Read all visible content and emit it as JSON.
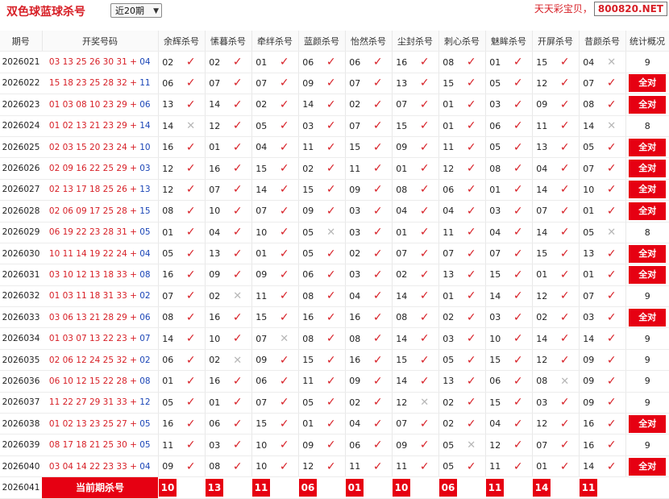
{
  "header": {
    "title": "双色球蓝球杀号",
    "period_select": "近20期",
    "brand": "天天彩宝贝",
    "site": "800820.NET"
  },
  "columns": [
    "期号",
    "开奖号码",
    "余辉杀号",
    "愫暮杀号",
    "牵绊杀号",
    "蓝颜杀号",
    "怡然杀号",
    "尘封杀号",
    "刺心杀号",
    "魅眸杀号",
    "开屏杀号",
    "昔颜杀号",
    "统计概况"
  ],
  "rows": [
    {
      "issue": "2026021",
      "red": "03 13 25 26 30 31",
      "blue": "04",
      "kills": [
        [
          "02",
          1
        ],
        [
          "02",
          1
        ],
        [
          "01",
          1
        ],
        [
          "06",
          1
        ],
        [
          "06",
          1
        ],
        [
          "16",
          1
        ],
        [
          "08",
          1
        ],
        [
          "01",
          1
        ],
        [
          "15",
          1
        ],
        [
          "04",
          0
        ]
      ],
      "stat": "9"
    },
    {
      "issue": "2026022",
      "red": "15 18 23 25 28 32",
      "blue": "11",
      "kills": [
        [
          "06",
          1
        ],
        [
          "07",
          1
        ],
        [
          "07",
          1
        ],
        [
          "09",
          1
        ],
        [
          "07",
          1
        ],
        [
          "13",
          1
        ],
        [
          "15",
          1
        ],
        [
          "05",
          1
        ],
        [
          "12",
          1
        ],
        [
          "07",
          1
        ]
      ],
      "stat": "全对"
    },
    {
      "issue": "2026023",
      "red": "01 03 08 10 23 29",
      "blue": "06",
      "kills": [
        [
          "13",
          1
        ],
        [
          "14",
          1
        ],
        [
          "02",
          1
        ],
        [
          "14",
          1
        ],
        [
          "02",
          1
        ],
        [
          "07",
          1
        ],
        [
          "01",
          1
        ],
        [
          "03",
          1
        ],
        [
          "09",
          1
        ],
        [
          "08",
          1
        ]
      ],
      "stat": "全对"
    },
    {
      "issue": "2026024",
      "red": "01 02 13 21 23 29",
      "blue": "14",
      "kills": [
        [
          "14",
          0
        ],
        [
          "12",
          1
        ],
        [
          "05",
          1
        ],
        [
          "03",
          1
        ],
        [
          "07",
          1
        ],
        [
          "15",
          1
        ],
        [
          "01",
          1
        ],
        [
          "06",
          1
        ],
        [
          "11",
          1
        ],
        [
          "14",
          0
        ]
      ],
      "stat": "8"
    },
    {
      "issue": "2026025",
      "red": "02 03 15 20 23 24",
      "blue": "10",
      "kills": [
        [
          "16",
          1
        ],
        [
          "01",
          1
        ],
        [
          "04",
          1
        ],
        [
          "11",
          1
        ],
        [
          "15",
          1
        ],
        [
          "09",
          1
        ],
        [
          "11",
          1
        ],
        [
          "05",
          1
        ],
        [
          "13",
          1
        ],
        [
          "05",
          1
        ]
      ],
      "stat": "全对"
    },
    {
      "issue": "2026026",
      "red": "02 09 16 22 25 29",
      "blue": "03",
      "kills": [
        [
          "12",
          1
        ],
        [
          "16",
          1
        ],
        [
          "15",
          1
        ],
        [
          "02",
          1
        ],
        [
          "11",
          1
        ],
        [
          "01",
          1
        ],
        [
          "12",
          1
        ],
        [
          "08",
          1
        ],
        [
          "04",
          1
        ],
        [
          "07",
          1
        ]
      ],
      "stat": "全对"
    },
    {
      "issue": "2026027",
      "red": "02 13 17 18 25 26",
      "blue": "13",
      "kills": [
        [
          "12",
          1
        ],
        [
          "07",
          1
        ],
        [
          "14",
          1
        ],
        [
          "15",
          1
        ],
        [
          "09",
          1
        ],
        [
          "08",
          1
        ],
        [
          "06",
          1
        ],
        [
          "01",
          1
        ],
        [
          "14",
          1
        ],
        [
          "10",
          1
        ]
      ],
      "stat": "全对"
    },
    {
      "issue": "2026028",
      "red": "02 06 09 17 25 28",
      "blue": "15",
      "kills": [
        [
          "08",
          1
        ],
        [
          "10",
          1
        ],
        [
          "07",
          1
        ],
        [
          "09",
          1
        ],
        [
          "03",
          1
        ],
        [
          "04",
          1
        ],
        [
          "04",
          1
        ],
        [
          "03",
          1
        ],
        [
          "07",
          1
        ],
        [
          "01",
          1
        ]
      ],
      "stat": "全对"
    },
    {
      "issue": "2026029",
      "red": "06 19 22 23 28 31",
      "blue": "05",
      "kills": [
        [
          "01",
          1
        ],
        [
          "04",
          1
        ],
        [
          "10",
          1
        ],
        [
          "05",
          0
        ],
        [
          "03",
          1
        ],
        [
          "01",
          1
        ],
        [
          "11",
          1
        ],
        [
          "04",
          1
        ],
        [
          "14",
          1
        ],
        [
          "05",
          0
        ]
      ],
      "stat": "8"
    },
    {
      "issue": "2026030",
      "red": "10 11 14 19 22 24",
      "blue": "04",
      "kills": [
        [
          "05",
          1
        ],
        [
          "13",
          1
        ],
        [
          "01",
          1
        ],
        [
          "05",
          1
        ],
        [
          "02",
          1
        ],
        [
          "07",
          1
        ],
        [
          "07",
          1
        ],
        [
          "07",
          1
        ],
        [
          "15",
          1
        ],
        [
          "13",
          1
        ]
      ],
      "stat": "全对"
    },
    {
      "issue": "2026031",
      "red": "03 10 12 13 18 33",
      "blue": "08",
      "kills": [
        [
          "16",
          1
        ],
        [
          "09",
          1
        ],
        [
          "09",
          1
        ],
        [
          "06",
          1
        ],
        [
          "03",
          1
        ],
        [
          "02",
          1
        ],
        [
          "13",
          1
        ],
        [
          "15",
          1
        ],
        [
          "01",
          1
        ],
        [
          "01",
          1
        ]
      ],
      "stat": "全对"
    },
    {
      "issue": "2026032",
      "red": "01 03 11 18 31 33",
      "blue": "02",
      "kills": [
        [
          "07",
          1
        ],
        [
          "02",
          0
        ],
        [
          "11",
          1
        ],
        [
          "08",
          1
        ],
        [
          "04",
          1
        ],
        [
          "14",
          1
        ],
        [
          "01",
          1
        ],
        [
          "14",
          1
        ],
        [
          "12",
          1
        ],
        [
          "07",
          1
        ]
      ],
      "stat": "9"
    },
    {
      "issue": "2026033",
      "red": "03 06 13 21 28 29",
      "blue": "06",
      "kills": [
        [
          "08",
          1
        ],
        [
          "16",
          1
        ],
        [
          "15",
          1
        ],
        [
          "16",
          1
        ],
        [
          "16",
          1
        ],
        [
          "08",
          1
        ],
        [
          "02",
          1
        ],
        [
          "03",
          1
        ],
        [
          "02",
          1
        ],
        [
          "03",
          1
        ]
      ],
      "stat": "全对"
    },
    {
      "issue": "2026034",
      "red": "01 03 07 13 22 23",
      "blue": "07",
      "kills": [
        [
          "14",
          1
        ],
        [
          "10",
          1
        ],
        [
          "07",
          0
        ],
        [
          "08",
          1
        ],
        [
          "08",
          1
        ],
        [
          "14",
          1
        ],
        [
          "03",
          1
        ],
        [
          "10",
          1
        ],
        [
          "14",
          1
        ],
        [
          "14",
          1
        ]
      ],
      "stat": "9"
    },
    {
      "issue": "2026035",
      "red": "02 06 12 24 25 32",
      "blue": "02",
      "kills": [
        [
          "06",
          1
        ],
        [
          "02",
          0
        ],
        [
          "09",
          1
        ],
        [
          "15",
          1
        ],
        [
          "16",
          1
        ],
        [
          "15",
          1
        ],
        [
          "05",
          1
        ],
        [
          "15",
          1
        ],
        [
          "12",
          1
        ],
        [
          "09",
          1
        ]
      ],
      "stat": "9"
    },
    {
      "issue": "2026036",
      "red": "06 10 12 15 22 28",
      "blue": "08",
      "kills": [
        [
          "01",
          1
        ],
        [
          "16",
          1
        ],
        [
          "06",
          1
        ],
        [
          "11",
          1
        ],
        [
          "09",
          1
        ],
        [
          "14",
          1
        ],
        [
          "13",
          1
        ],
        [
          "06",
          1
        ],
        [
          "08",
          0
        ],
        [
          "09",
          1
        ]
      ],
      "stat": "9"
    },
    {
      "issue": "2026037",
      "red": "11 22 27 29 31 33",
      "blue": "12",
      "kills": [
        [
          "05",
          1
        ],
        [
          "01",
          1
        ],
        [
          "07",
          1
        ],
        [
          "05",
          1
        ],
        [
          "02",
          1
        ],
        [
          "12",
          0
        ],
        [
          "02",
          1
        ],
        [
          "15",
          1
        ],
        [
          "03",
          1
        ],
        [
          "09",
          1
        ]
      ],
      "stat": "9"
    },
    {
      "issue": "2026038",
      "red": "01 02 13 23 25 27",
      "blue": "05",
      "kills": [
        [
          "16",
          1
        ],
        [
          "06",
          1
        ],
        [
          "15",
          1
        ],
        [
          "01",
          1
        ],
        [
          "04",
          1
        ],
        [
          "07",
          1
        ],
        [
          "02",
          1
        ],
        [
          "04",
          1
        ],
        [
          "12",
          1
        ],
        [
          "16",
          1
        ]
      ],
      "stat": "全对"
    },
    {
      "issue": "2026039",
      "red": "08 17 18 21 25 30",
      "blue": "05",
      "kills": [
        [
          "11",
          1
        ],
        [
          "03",
          1
        ],
        [
          "10",
          1
        ],
        [
          "09",
          1
        ],
        [
          "06",
          1
        ],
        [
          "09",
          1
        ],
        [
          "05",
          0
        ],
        [
          "12",
          1
        ],
        [
          "07",
          1
        ],
        [
          "16",
          1
        ]
      ],
      "stat": "9"
    },
    {
      "issue": "2026040",
      "red": "03 04 14 22 23 33",
      "blue": "04",
      "kills": [
        [
          "09",
          1
        ],
        [
          "08",
          1
        ],
        [
          "10",
          1
        ],
        [
          "12",
          1
        ],
        [
          "11",
          1
        ],
        [
          "11",
          1
        ],
        [
          "05",
          1
        ],
        [
          "11",
          1
        ],
        [
          "01",
          1
        ],
        [
          "14",
          1
        ]
      ],
      "stat": "全对"
    }
  ],
  "current": {
    "issue": "2026041",
    "label": "当前期杀号",
    "values": [
      "10",
      "13",
      "11",
      "06",
      "01",
      "10",
      "06",
      "11",
      "14",
      "11"
    ]
  },
  "marks": {
    "ok": "✓",
    "no": "✕"
  },
  "colors": {
    "red": "#d71f26",
    "blue": "#1b46b7",
    "badge": "#e60012",
    "miss": "#b6b6b6"
  }
}
